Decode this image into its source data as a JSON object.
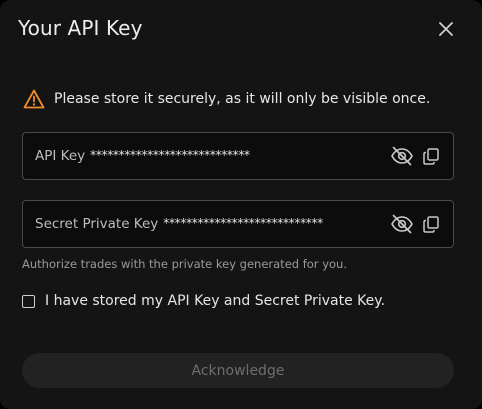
{
  "dialog": {
    "title": "Your API Key",
    "close_icon": "close-icon"
  },
  "warning": {
    "icon": "warning-icon",
    "text": "Please store it securely, as it will only be visible once.",
    "color": "#f08c2e"
  },
  "fields": [
    {
      "label": "API Key",
      "value": "****************************",
      "visibility_icon": "eye-off-icon",
      "copy_icon": "copy-icon"
    },
    {
      "label": "Secret Private Key",
      "value": "****************************",
      "visibility_icon": "eye-off-icon",
      "copy_icon": "copy-icon"
    }
  ],
  "helper_text": "Authorize trades with the private key generated for you.",
  "confirmation": {
    "label": "I have stored my API Key and Secret Private Key.",
    "checked": false
  },
  "acknowledge_label": "Acknowledge"
}
